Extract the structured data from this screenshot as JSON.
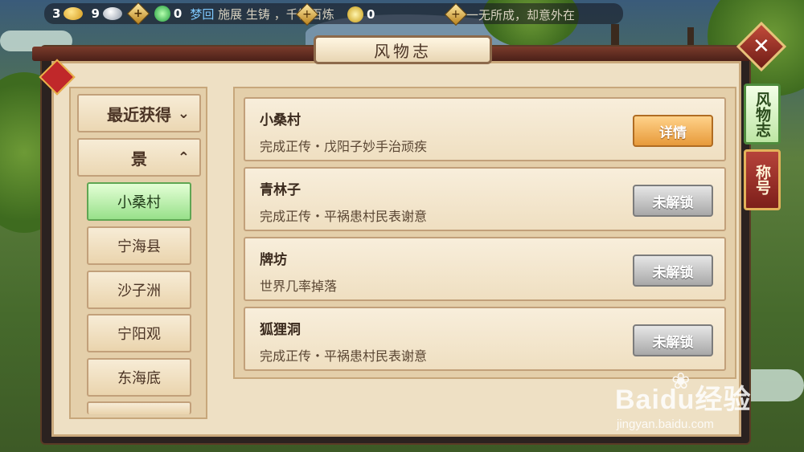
{
  "hud": {
    "gold": "3",
    "silver": "9",
    "jade": "0",
    "yuanbao": "0",
    "ticker_highlight": "梦回",
    "ticker_text1": "施展",
    "ticker_text2": "生铸",
    "ticker_text3": "，千锤百炼",
    "ticker_text4": "一无所成，却意外在"
  },
  "window": {
    "title": "风物志"
  },
  "side_tabs": [
    "风物志",
    "称号"
  ],
  "categories": [
    {
      "label": "最近获得",
      "chevron": "⌄"
    },
    {
      "label": "景",
      "chevron": "⌃"
    }
  ],
  "places": [
    "小桑村",
    "宁海县",
    "沙子洲",
    "宁阳观",
    "东海底"
  ],
  "entries": [
    {
      "name": "小桑村",
      "desc": "完成正传・戊阳子妙手治顽疾",
      "action": "详情"
    },
    {
      "name": "青林子",
      "desc": "完成正传・平祸患村民表谢意",
      "action": "未解锁"
    },
    {
      "name": "牌坊",
      "desc": "世界几率掉落",
      "action": "未解锁"
    },
    {
      "name": "狐狸洞",
      "desc": "完成正传・平祸患村民表谢意",
      "action": "未解锁"
    }
  ],
  "watermark": {
    "brand": "Baidu经验",
    "site": "jingyan.baidu.com"
  }
}
